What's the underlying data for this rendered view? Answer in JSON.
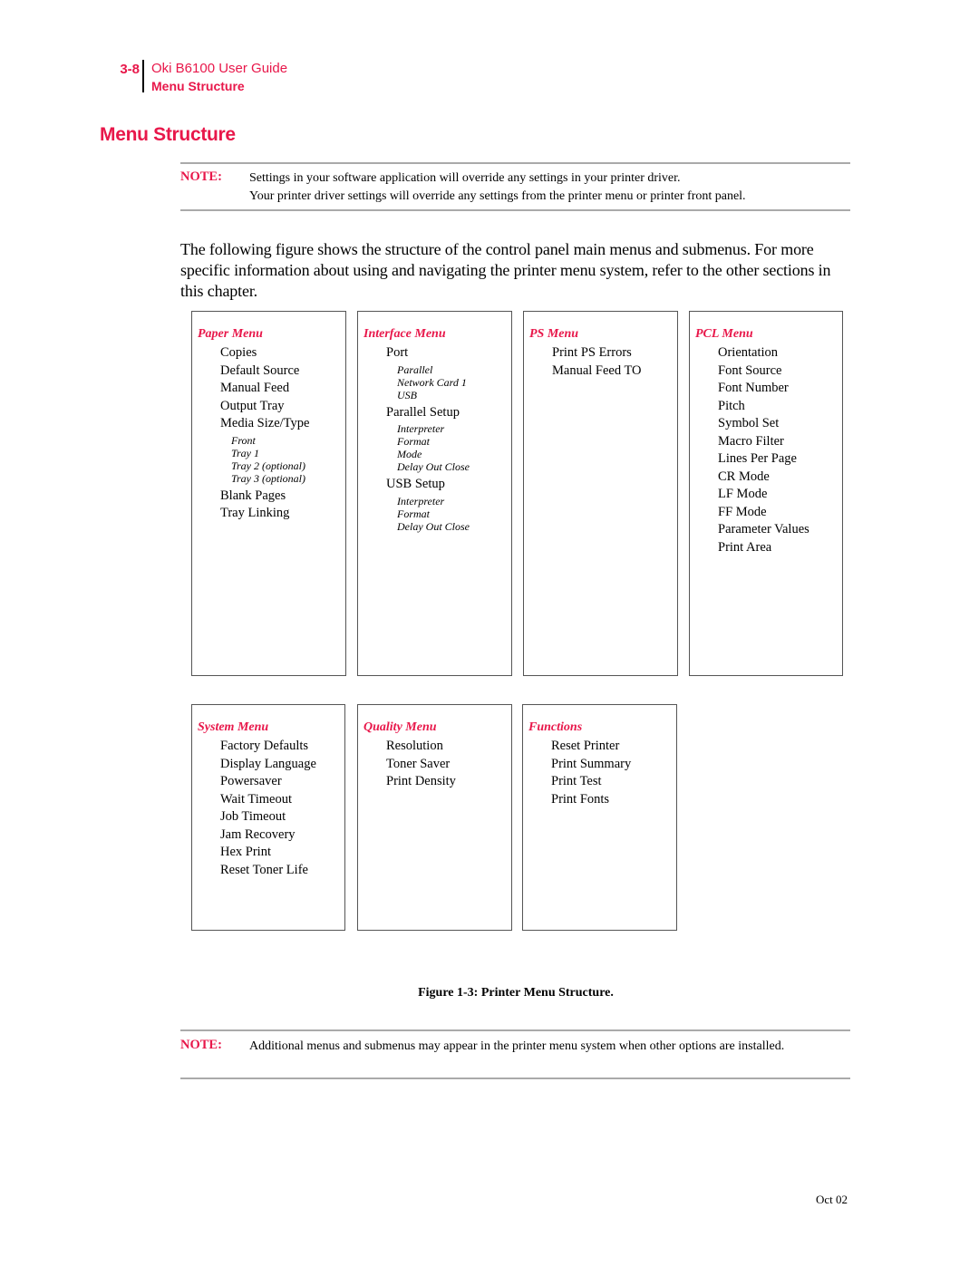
{
  "header": {
    "page_number": "3-8",
    "guide_title": "Oki B6100 User Guide",
    "section": "Menu Structure"
  },
  "page_title": "Menu Structure",
  "note_top": {
    "label": "NOTE:",
    "lines": [
      "Settings in your software application will override any settings in your printer driver.",
      "Your printer driver settings will override any settings from the printer menu or printer front panel."
    ]
  },
  "body_paragraph": "The following figure shows the structure of the control panel main menus and submenus. For more specific information about using and navigating the printer menu system, refer to the other sections in this chapter.",
  "menus": [
    {
      "title": "Paper Menu",
      "items": [
        {
          "label": "Copies"
        },
        {
          "label": "Default Source"
        },
        {
          "label": "Manual Feed"
        },
        {
          "label": "Output Tray"
        },
        {
          "label": "Media Size/Type",
          "sub": [
            "Front",
            "Tray 1",
            "Tray 2 (optional)",
            "Tray 3 (optional)"
          ]
        },
        {
          "label": "Blank Pages"
        },
        {
          "label": "Tray Linking"
        }
      ]
    },
    {
      "title": "Interface Menu",
      "items": [
        {
          "label": "Port",
          "sub": [
            "Parallel",
            "Network Card 1",
            "USB"
          ]
        },
        {
          "label": "Parallel Setup",
          "sub": [
            "Interpreter",
            "Format",
            "Mode",
            "Delay Out Close"
          ]
        },
        {
          "label": "USB Setup",
          "sub": [
            "Interpreter",
            "Format",
            "Delay Out Close"
          ]
        }
      ]
    },
    {
      "title": "PS Menu",
      "items": [
        {
          "label": "Print PS Errors"
        },
        {
          "label": "Manual Feed TO"
        }
      ]
    },
    {
      "title": "PCL Menu",
      "items": [
        {
          "label": "Orientation"
        },
        {
          "label": "Font Source"
        },
        {
          "label": "Font Number"
        },
        {
          "label": "Pitch"
        },
        {
          "label": "Symbol Set"
        },
        {
          "label": "Macro Filter"
        },
        {
          "label": "Lines Per Page"
        },
        {
          "label": "CR Mode"
        },
        {
          "label": "LF Mode"
        },
        {
          "label": "FF Mode"
        },
        {
          "label": "Parameter Values"
        },
        {
          "label": "Print Area"
        }
      ]
    },
    {
      "title": "System Menu",
      "items": [
        {
          "label": "Factory Defaults"
        },
        {
          "label": "Display Language"
        },
        {
          "label": "Powersaver"
        },
        {
          "label": "Wait Timeout"
        },
        {
          "label": "Job Timeout"
        },
        {
          "label": "Jam Recovery"
        },
        {
          "label": "Hex Print"
        },
        {
          "label": "Reset Toner Life"
        }
      ]
    },
    {
      "title": "Quality Menu",
      "items": [
        {
          "label": "Resolution"
        },
        {
          "label": "Toner Saver"
        },
        {
          "label": "Print Density"
        }
      ]
    },
    {
      "title": "Functions",
      "items": [
        {
          "label": "Reset Printer"
        },
        {
          "label": "Print Summary"
        },
        {
          "label": "Print Test"
        },
        {
          "label": "Print Fonts"
        }
      ]
    }
  ],
  "figure_caption": "Figure 1-3:  Printer Menu Structure.",
  "note_bottom": {
    "label": "NOTE:",
    "text": "Additional menus and submenus may appear in the printer menu system when other options are installed."
  },
  "footer": {
    "date": "Oct 02"
  },
  "colors": {
    "accent": "#e8174a",
    "rule": "#aaaaaa",
    "box_border": "#555555"
  }
}
